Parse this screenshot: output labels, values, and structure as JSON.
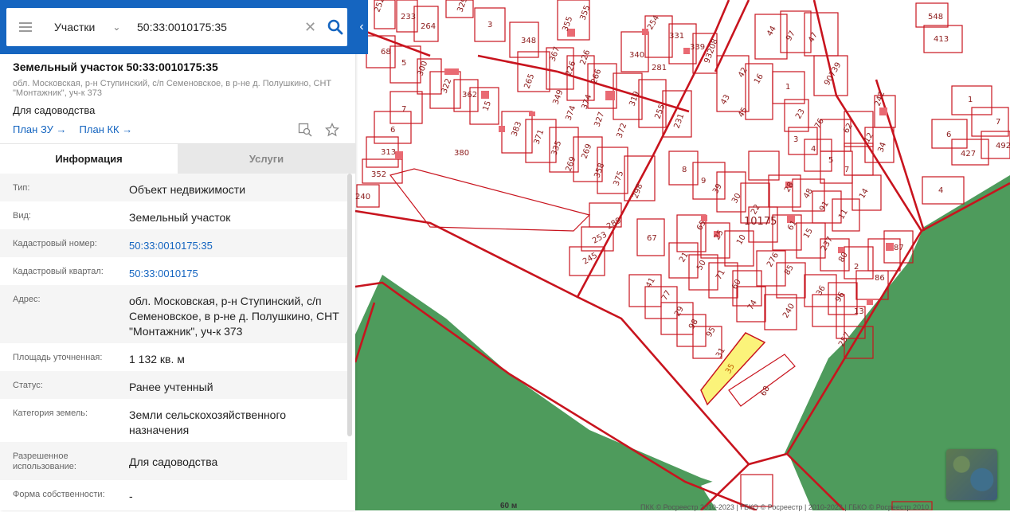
{
  "search": {
    "selector_label": "Участки",
    "query": "50:33:0010175:35"
  },
  "card": {
    "title": "Земельный участок 50:33:0010175:35",
    "address": "обл. Московская, р-н Ступинский, с/п Семеновское, в р-не д. Полушкино, СНТ \"Монтажник\", уч-к 373",
    "purpose": "Для садоводства",
    "link_zu": "План ЗУ →",
    "link_kk": "План КК →"
  },
  "tabs": {
    "info": "Информация",
    "services": "Услуги"
  },
  "rows": [
    {
      "key": "Тип:",
      "value": "Объект недвижимости"
    },
    {
      "key": "Вид:",
      "value": "Земельный участок"
    },
    {
      "key": "Кадастровый номер:",
      "value": "50:33:0010175:35"
    },
    {
      "key": "Кадастровый квартал:",
      "value": "50:33:0010175"
    },
    {
      "key": "Адрес:",
      "value": "обл. Московская, р-н Ступинский, с/п Семеновское, в р-не д. Полушкино, СНТ \"Монтажник\", уч-к 373"
    },
    {
      "key": "Площадь уточненная:",
      "value": "1 132 кв. м"
    },
    {
      "key": "Статус:",
      "value": "Ранее учтенный"
    },
    {
      "key": "Категория земель:",
      "value": "Земли сельскохозяйственного назначения"
    },
    {
      "key": "Разрешенное использование:",
      "value": "Для садоводства"
    },
    {
      "key": "Форма собственности:",
      "value": "-"
    }
  ],
  "map": {
    "quarter_label": "10175",
    "selected_label": "35",
    "scale": "60 м",
    "colors": {
      "border": "#c8141e",
      "forest": "#4e9b5c",
      "selected": "#fbf37a"
    },
    "parcel_labels": [
      "252",
      "233",
      "264",
      "329",
      "355",
      "355",
      "254",
      "331",
      "339",
      "3",
      "348",
      "68",
      "5",
      "300",
      "322",
      "362",
      "15",
      "367",
      "226",
      "340",
      "281",
      "93208",
      "44",
      "97",
      "47",
      "548",
      "413",
      "7",
      "6",
      "313",
      "352",
      "240",
      "380",
      "265",
      "349",
      "374",
      "266",
      "319",
      "43",
      "42",
      "16",
      "1",
      "90739",
      "242",
      "1",
      "7",
      "383",
      "371",
      "335",
      "374",
      "327",
      "372",
      "255",
      "45",
      "23",
      "76",
      "62",
      "12",
      "6",
      "427",
      "492",
      "269",
      "269",
      "358",
      "375",
      "298",
      "231",
      "3",
      "4",
      "5",
      "7",
      "34",
      "4",
      "8",
      "9",
      "39",
      "30",
      "22",
      "28",
      "48",
      "91",
      "14",
      "289",
      "253",
      "245",
      "67",
      "65",
      "25",
      "10",
      "61",
      "15",
      "11",
      "87",
      "21",
      "50",
      "71",
      "60",
      "276",
      "237",
      "80",
      "2",
      "41",
      "77",
      "85",
      "36",
      "86",
      "29",
      "74",
      "240",
      "96",
      "13",
      "98",
      "95",
      "31",
      "257",
      "68"
    ]
  },
  "footer": {
    "copyright": "ПКК © Росреестр 2010-2023 | ГБКО © Росреестр | 2010-2023 | ГБКО © Росреестр 2010"
  }
}
